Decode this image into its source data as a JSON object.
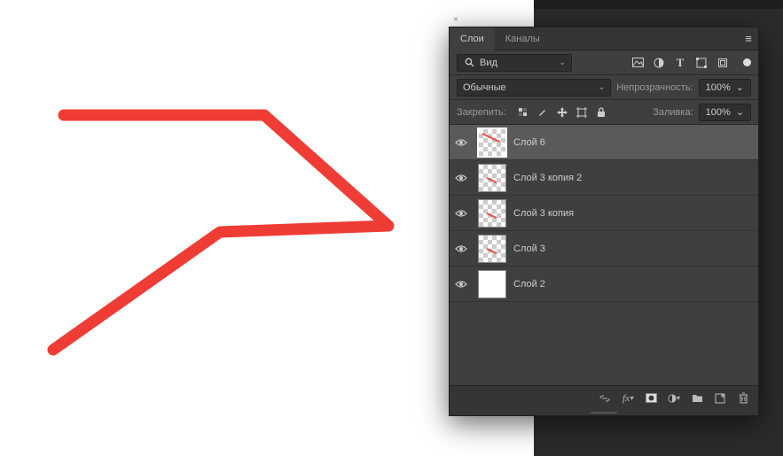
{
  "tabs": {
    "layers": "Слои",
    "channels": "Каналы"
  },
  "filter": {
    "icon_label": "search",
    "kind_label": "Вид"
  },
  "filter_icons": [
    "image-icon",
    "adjust-icon",
    "type-icon",
    "shape-icon",
    "smart-icon"
  ],
  "blend": {
    "mode": "Обычные",
    "opacity_label": "Непрозрачность:",
    "opacity_value": "100%"
  },
  "lock": {
    "label": "Закрепить:",
    "fill_label": "Заливка:",
    "fill_value": "100%"
  },
  "lock_icons": [
    "lock-pixels-icon",
    "lock-brush-icon",
    "lock-move-icon",
    "lock-artboard-icon",
    "lock-all-icon"
  ],
  "layers": [
    {
      "name": "Слой 6",
      "selected": true,
      "checker": true,
      "mark": "full"
    },
    {
      "name": "Слой 3 копия 2",
      "selected": false,
      "checker": true,
      "mark": "small"
    },
    {
      "name": "Слой 3 копия",
      "selected": false,
      "checker": true,
      "mark": "small"
    },
    {
      "name": "Слой 3",
      "selected": false,
      "checker": true,
      "mark": "small"
    },
    {
      "name": "Слой 2",
      "selected": false,
      "checker": false,
      "mark": "none"
    }
  ],
  "bottom_icons": [
    "link-icon",
    "fx-icon",
    "mask-icon",
    "adjustment-icon",
    "group-icon",
    "new-layer-icon",
    "trash-icon"
  ],
  "colors": {
    "stroke": "#ef3c34"
  }
}
